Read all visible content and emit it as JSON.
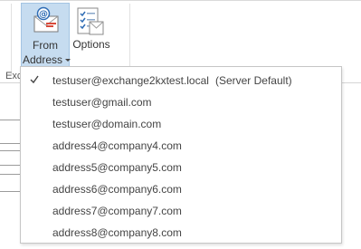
{
  "ribbon": {
    "group_label": "Exc",
    "from_button": {
      "line1": "From",
      "line2": "Address",
      "icon": "at-envelope-icon"
    },
    "options_button": {
      "label": "Options",
      "icon": "checklist-options-icon"
    }
  },
  "from_menu": {
    "items": [
      {
        "address": "testuser@exchange2kxtest.local",
        "note": "(Server Default)",
        "checked": true
      },
      {
        "address": "testuser@gmail.com",
        "note": "",
        "checked": false
      },
      {
        "address": "testuser@domain.com",
        "note": "",
        "checked": false
      },
      {
        "address": "address4@company4.com",
        "note": "",
        "checked": false
      },
      {
        "address": "address5@company5.com",
        "note": "",
        "checked": false
      },
      {
        "address": "address6@company6.com",
        "note": "",
        "checked": false
      },
      {
        "address": "address7@company7.com",
        "note": "",
        "checked": false
      },
      {
        "address": "address8@company8.com",
        "note": "",
        "checked": false
      }
    ]
  },
  "colors": {
    "selected_button_bg": "#c6dcf0",
    "selected_button_border": "#a3c4e3",
    "text": "#444444"
  }
}
